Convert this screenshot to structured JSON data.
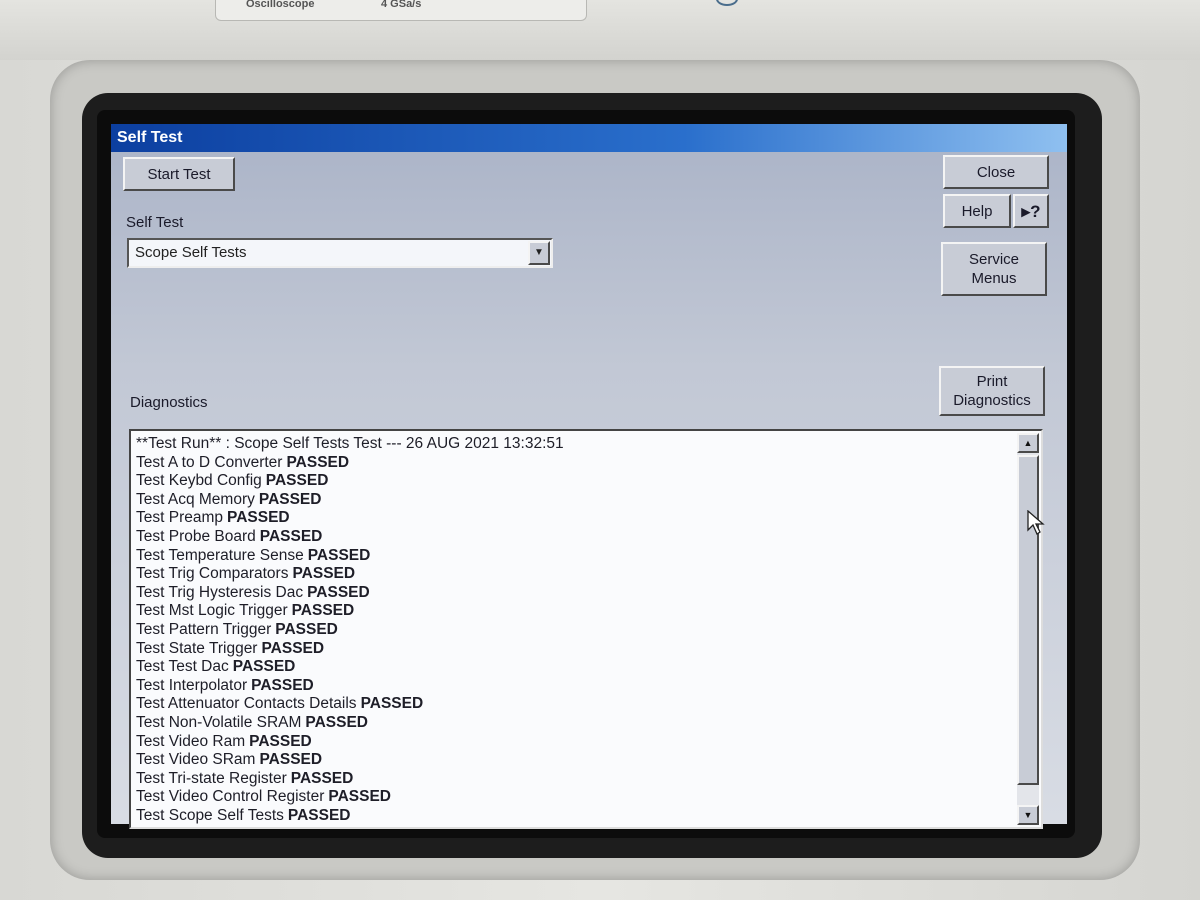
{
  "instrument": {
    "strip_left": "Oscilloscope",
    "strip_right": "4 GSa/s"
  },
  "window": {
    "title": "Self Test"
  },
  "buttons": {
    "start_test": "Start Test",
    "close": "Close",
    "help": "Help",
    "whats_this": "▸?",
    "service_menus_line1": "Service",
    "service_menus_line2": "Menus",
    "print_diag_line1": "Print",
    "print_diag_line2": "Diagnostics"
  },
  "self_test": {
    "label": "Self Test",
    "selected": "Scope Self Tests",
    "arrow": "▼"
  },
  "diagnostics": {
    "label": "Diagnostics",
    "header": "**Test Run** : Scope Self Tests Test  --- 26 AUG 2021 13:32:51",
    "lines": [
      {
        "name": "Test A to D Converter",
        "status": "PASSED"
      },
      {
        "name": "Test Keybd Config",
        "status": "PASSED"
      },
      {
        "name": "Test Acq Memory",
        "status": "PASSED"
      },
      {
        "name": "Test Preamp",
        "status": "PASSED"
      },
      {
        "name": "Test Probe Board",
        "status": "PASSED"
      },
      {
        "name": "Test Temperature Sense",
        "status": "PASSED"
      },
      {
        "name": "Test Trig Comparators",
        "status": "PASSED"
      },
      {
        "name": "Test Trig Hysteresis Dac",
        "status": "PASSED"
      },
      {
        "name": "Test Mst Logic Trigger",
        "status": "PASSED"
      },
      {
        "name": "Test Pattern Trigger",
        "status": "PASSED"
      },
      {
        "name": "Test State Trigger",
        "status": "PASSED"
      },
      {
        "name": "Test Test Dac",
        "status": "PASSED"
      },
      {
        "name": "Test Interpolator",
        "status": "PASSED"
      },
      {
        "name": "Test Attenuator Contacts Details",
        "status": "PASSED"
      },
      {
        "name": "Test Non-Volatile SRAM",
        "status": "PASSED"
      },
      {
        "name": "Test Video Ram",
        "status": "PASSED"
      },
      {
        "name": "Test Video SRam",
        "status": "PASSED"
      },
      {
        "name": "Test Tri-state Register",
        "status": "PASSED"
      },
      {
        "name": "Test Video Control Register",
        "status": "PASSED"
      },
      {
        "name": "Test Scope Self Tests",
        "status": "PASSED"
      }
    ],
    "scroll_up": "▲",
    "scroll_down": "▼"
  }
}
